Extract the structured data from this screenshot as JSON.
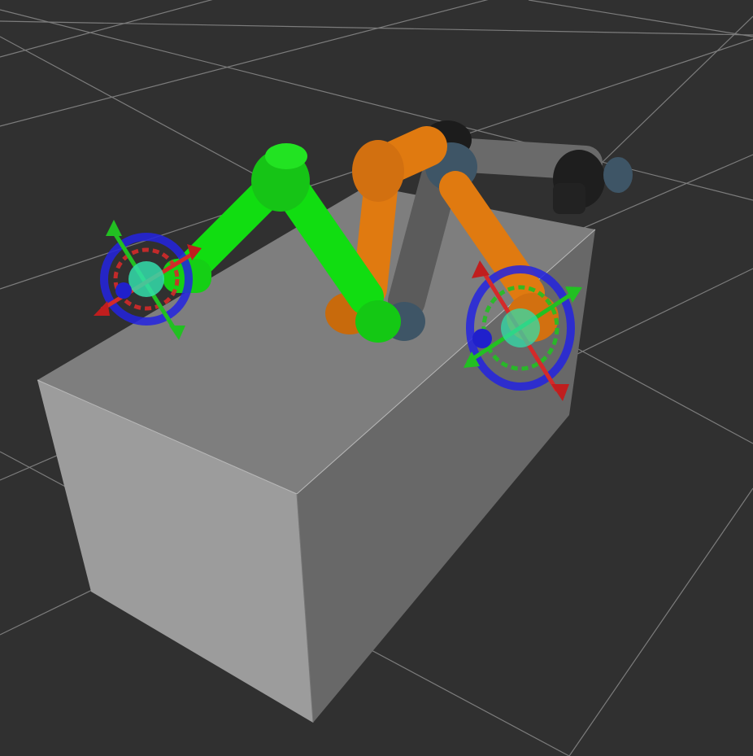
{
  "viewport": {
    "background": "#303030",
    "grid_color": "#8a8a8a",
    "has_text": false
  },
  "scene": {
    "table": {
      "top": "#7e7e7e",
      "front": "#9a9a9a",
      "side": "#6a6a6a"
    },
    "arms": [
      {
        "name": "arm-green",
        "color": "#11dd11",
        "state": "goal"
      },
      {
        "name": "arm-orange",
        "color": "#e07a10",
        "state": "goal"
      },
      {
        "name": "arm-dark",
        "color": "#5e5e5e",
        "accent": "#3e5566",
        "state": "current"
      }
    ],
    "markers": [
      {
        "name": "interactive-marker-left",
        "ring": "#2323e0",
        "x_axis": "#d42a2a",
        "y_axis": "#22c022",
        "handle": "#33ddaa"
      },
      {
        "name": "interactive-marker-right",
        "ring": "#2323e0",
        "x_axis": "#d42a2a",
        "y_axis": "#22c022",
        "handle": "#33ddaa"
      }
    ]
  }
}
